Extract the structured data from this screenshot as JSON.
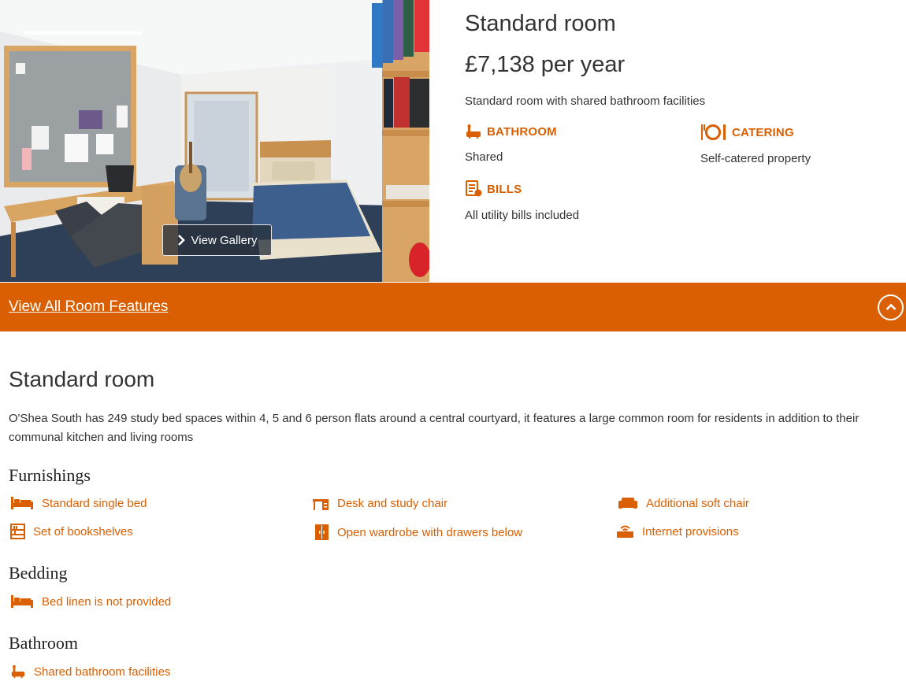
{
  "gallery": {
    "button_label": "View Gallery"
  },
  "room": {
    "title": "Standard room",
    "price": "£7,138 per year",
    "description": "Standard room with shared bathroom facilities"
  },
  "features": [
    {
      "heading": "BATHROOM",
      "value": "Shared",
      "icon": "bath-icon"
    },
    {
      "heading": "CATERING",
      "value": "Self-catered property",
      "icon": "plate-cutlery-icon"
    },
    {
      "heading": "BILLS",
      "value": "All utility bills included",
      "icon": "bills-icon"
    }
  ],
  "bar": {
    "link_label": "View All Room Features",
    "toggle_icon": "chevron-up-icon"
  },
  "details": {
    "title": "Standard room",
    "paragraph": "O'Shea South has 249 study bed spaces within 4, 5 and 6 person flats around a central courtyard, it features a large common room for residents in addition to their communal kitchen and living rooms"
  },
  "sections": {
    "furnishings": {
      "heading": "Furnishings",
      "items": [
        {
          "label": "Standard single bed",
          "icon": "bed-icon"
        },
        {
          "label": "Desk and study chair",
          "icon": "desk-icon"
        },
        {
          "label": "Additional soft chair",
          "icon": "sofa-icon"
        },
        {
          "label": "Set of bookshelves",
          "icon": "bookshelf-icon"
        },
        {
          "label": "Open wardrobe with drawers below",
          "icon": "wardrobe-icon"
        },
        {
          "label": "Internet provisions",
          "icon": "router-icon"
        }
      ]
    },
    "bedding": {
      "heading": "Bedding",
      "items": [
        {
          "label": "Bed linen is not provided",
          "icon": "bed-icon"
        }
      ]
    },
    "bathroom": {
      "heading": "Bathroom",
      "items": [
        {
          "label": "Shared bathroom facilities",
          "icon": "bath-icon"
        }
      ]
    }
  },
  "colors": {
    "accent": "#d95f02",
    "text": "#333333",
    "bar_text": "#ffffff"
  }
}
